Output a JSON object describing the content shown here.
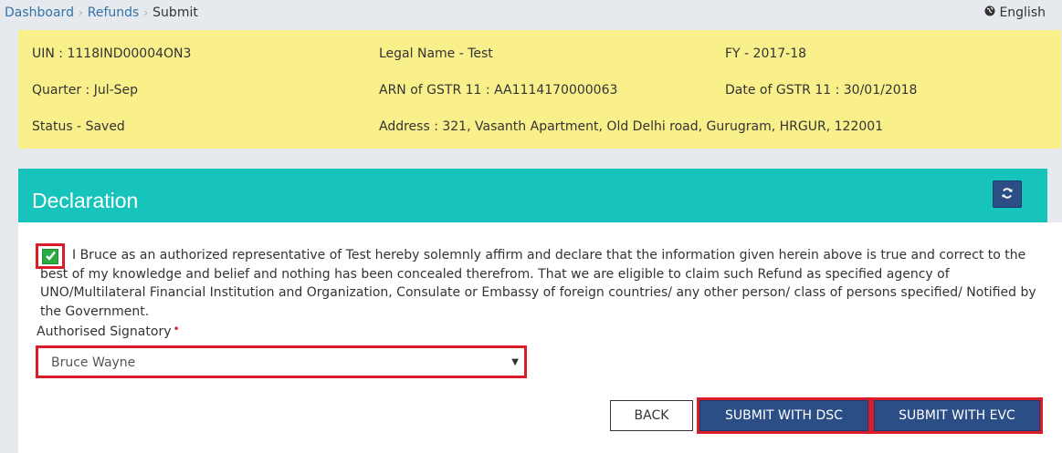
{
  "breadcrumb": {
    "items": [
      "Dashboard",
      "Refunds"
    ],
    "current": "Submit",
    "separator": "›"
  },
  "language": {
    "label": "English",
    "icon": "globe-icon"
  },
  "info": {
    "uin": "UIN : 1118IND00004ON3",
    "legal_name": "Legal Name - Test",
    "fy": "FY - 2017-18",
    "quarter": "Quarter : Jul-Sep",
    "arn": "ARN of GSTR 11 : AA1114170000063",
    "date_gstr": "Date of GSTR 11 : 30/01/2018",
    "status": "Status - Saved",
    "address": "Address : 321, Vasanth Apartment, Old Delhi road, Gurugram, HRGUR, 122001"
  },
  "panel": {
    "title": "Declaration",
    "refresh_icon": "refresh-icon"
  },
  "declaration": {
    "checked": true,
    "text": "I Bruce as an authorized representative of Test hereby solemnly affirm and declare that the information given herein above is true and correct to the best of my knowledge and belief and nothing has been concealed therefrom. That we are eligible to claim such Refund as specified agency of UNO/Multilateral Financial Institution and Organization, Consulate or Embassy of foreign countries/ any other person/ class of persons specified/ Notified by the Government."
  },
  "signatory": {
    "label": "Authorised Signatory",
    "required_mark": "•",
    "selected": "Bruce Wayne"
  },
  "buttons": {
    "back": "BACK",
    "submit_dsc": "SUBMIT WITH DSC",
    "submit_evc": "SUBMIT WITH EVC"
  },
  "colors": {
    "panel_header": "#17c4bb",
    "info_box": "#f9f08c",
    "primary_button": "#2c4e86",
    "highlight": "#d81c28",
    "link": "#3272a8"
  }
}
